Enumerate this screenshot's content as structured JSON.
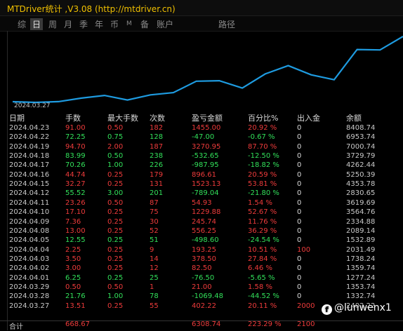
{
  "window": {
    "title": "MTDriver统计 ,V3.08 (http://mtdriver.cn)"
  },
  "tabs": [
    {
      "label": "综"
    },
    {
      "label": "日"
    },
    {
      "label": "周"
    },
    {
      "label": "月"
    },
    {
      "label": "季"
    },
    {
      "label": "年"
    },
    {
      "label": "币"
    },
    {
      "label": "M"
    },
    {
      "label": "备"
    },
    {
      "label": "账户"
    },
    {
      "label": "路径"
    }
  ],
  "active_tab": "日",
  "chart": {
    "start_date": "2024.03.27",
    "line_color": "#1e9be0"
  },
  "chart_data": {
    "type": "line",
    "series": [
      {
        "values": [
          1353.74,
          1277.24,
          1359.74,
          1738.24,
          2031.49,
          1532.89,
          2089.14,
          2334.88,
          3564.76,
          3619.69,
          2830.65,
          4353.78,
          5250.39,
          4262.44,
          3729.79,
          7000.74,
          6953.74,
          8408.74
        ]
      }
    ]
  },
  "table": {
    "headers": [
      "日期",
      "手数",
      "最大手数",
      "次数",
      "盈亏金额",
      "百分比%",
      "出入金",
      "余额"
    ],
    "rows": [
      {
        "date": "2024.04.23",
        "hands": "91.00",
        "max": "0.50",
        "count": "182",
        "pnl": "1455.00",
        "pct": "20.92 %",
        "flow": "0",
        "bal": "8408.74",
        "color": "red"
      },
      {
        "date": "2024.04.22",
        "hands": "72.25",
        "max": "0.75",
        "count": "128",
        "pnl": "-47.00",
        "pct": "-0.67 %",
        "flow": "0",
        "bal": "6953.74",
        "color": "green"
      },
      {
        "date": "2024.04.19",
        "hands": "94.70",
        "max": "2.00",
        "count": "187",
        "pnl": "3270.95",
        "pct": "87.70 %",
        "flow": "0",
        "bal": "7000.74",
        "color": "red"
      },
      {
        "date": "2024.04.18",
        "hands": "83.99",
        "max": "0.50",
        "count": "238",
        "pnl": "-532.65",
        "pct": "-12.50 %",
        "flow": "0",
        "bal": "3729.79",
        "color": "green"
      },
      {
        "date": "2024.04.17",
        "hands": "70.26",
        "max": "1.00",
        "count": "226",
        "pnl": "-987.95",
        "pct": "-18.82 %",
        "flow": "0",
        "bal": "4262.44",
        "color": "green"
      },
      {
        "date": "2024.04.16",
        "hands": "44.74",
        "max": "0.25",
        "count": "179",
        "pnl": "896.61",
        "pct": "20.59 %",
        "flow": "0",
        "bal": "5250.39",
        "color": "red"
      },
      {
        "date": "2024.04.15",
        "hands": "32.27",
        "max": "0.25",
        "count": "131",
        "pnl": "1523.13",
        "pct": "53.81 %",
        "flow": "0",
        "bal": "4353.78",
        "color": "red"
      },
      {
        "date": "2024.04.12",
        "hands": "55.52",
        "max": "3.00",
        "count": "201",
        "pnl": "-789.04",
        "pct": "-21.80 %",
        "flow": "0",
        "bal": "2830.65",
        "color": "green"
      },
      {
        "date": "2024.04.11",
        "hands": "23.26",
        "max": "0.50",
        "count": "87",
        "pnl": "54.93",
        "pct": "1.54 %",
        "flow": "0",
        "bal": "3619.69",
        "color": "red"
      },
      {
        "date": "2024.04.10",
        "hands": "17.10",
        "max": "0.25",
        "count": "75",
        "pnl": "1229.88",
        "pct": "52.67 %",
        "flow": "0",
        "bal": "3564.76",
        "color": "red"
      },
      {
        "date": "2024.04.09",
        "hands": "7.36",
        "max": "0.25",
        "count": "30",
        "pnl": "245.74",
        "pct": "11.76 %",
        "flow": "0",
        "bal": "2334.88",
        "color": "red"
      },
      {
        "date": "2024.04.08",
        "hands": "13.00",
        "max": "0.25",
        "count": "52",
        "pnl": "556.25",
        "pct": "36.29 %",
        "flow": "0",
        "bal": "2089.14",
        "color": "red"
      },
      {
        "date": "2024.04.05",
        "hands": "12.55",
        "max": "0.25",
        "count": "51",
        "pnl": "-498.60",
        "pct": "-24.54 %",
        "flow": "0",
        "bal": "1532.89",
        "color": "green"
      },
      {
        "date": "2024.04.04",
        "hands": "2.25",
        "max": "0.25",
        "count": "9",
        "pnl": "193.25",
        "pct": "10.51 %",
        "flow": "100",
        "bal": "2031.49",
        "color": "red"
      },
      {
        "date": "2024.04.03",
        "hands": "3.50",
        "max": "0.25",
        "count": "14",
        "pnl": "378.50",
        "pct": "27.84 %",
        "flow": "0",
        "bal": "1738.24",
        "color": "red"
      },
      {
        "date": "2024.04.02",
        "hands": "3.00",
        "max": "0.25",
        "count": "12",
        "pnl": "82.50",
        "pct": "6.46 %",
        "flow": "0",
        "bal": "1359.74",
        "color": "red"
      },
      {
        "date": "2024.04.01",
        "hands": "6.25",
        "max": "0.25",
        "count": "25",
        "pnl": "-76.50",
        "pct": "-5.65 %",
        "flow": "0",
        "bal": "1277.24",
        "color": "green"
      },
      {
        "date": "2024.03.29",
        "hands": "0.50",
        "max": "0.50",
        "count": "1",
        "pnl": "21.00",
        "pct": "1.58 %",
        "flow": "0",
        "bal": "1353.74",
        "color": "red"
      },
      {
        "date": "2024.03.28",
        "hands": "21.76",
        "max": "1.00",
        "count": "78",
        "pnl": "-1069.48",
        "pct": "-44.52 %",
        "flow": "0",
        "bal": "1332.74",
        "color": "green"
      },
      {
        "date": "2024.03.27",
        "hands": "13.51",
        "max": "0.25",
        "count": "55",
        "pnl": "402.22",
        "pct": "20.11 %",
        "flow": "2000",
        "bal": "2402.22",
        "color": "red"
      }
    ],
    "total": {
      "label": "合计",
      "hands": "668.67",
      "pnl": "6308.74",
      "pct": "223.29 %",
      "flow": "2100"
    }
  },
  "watermark": {
    "text": "@lunwenx1",
    "icon": "facebook-icon"
  }
}
